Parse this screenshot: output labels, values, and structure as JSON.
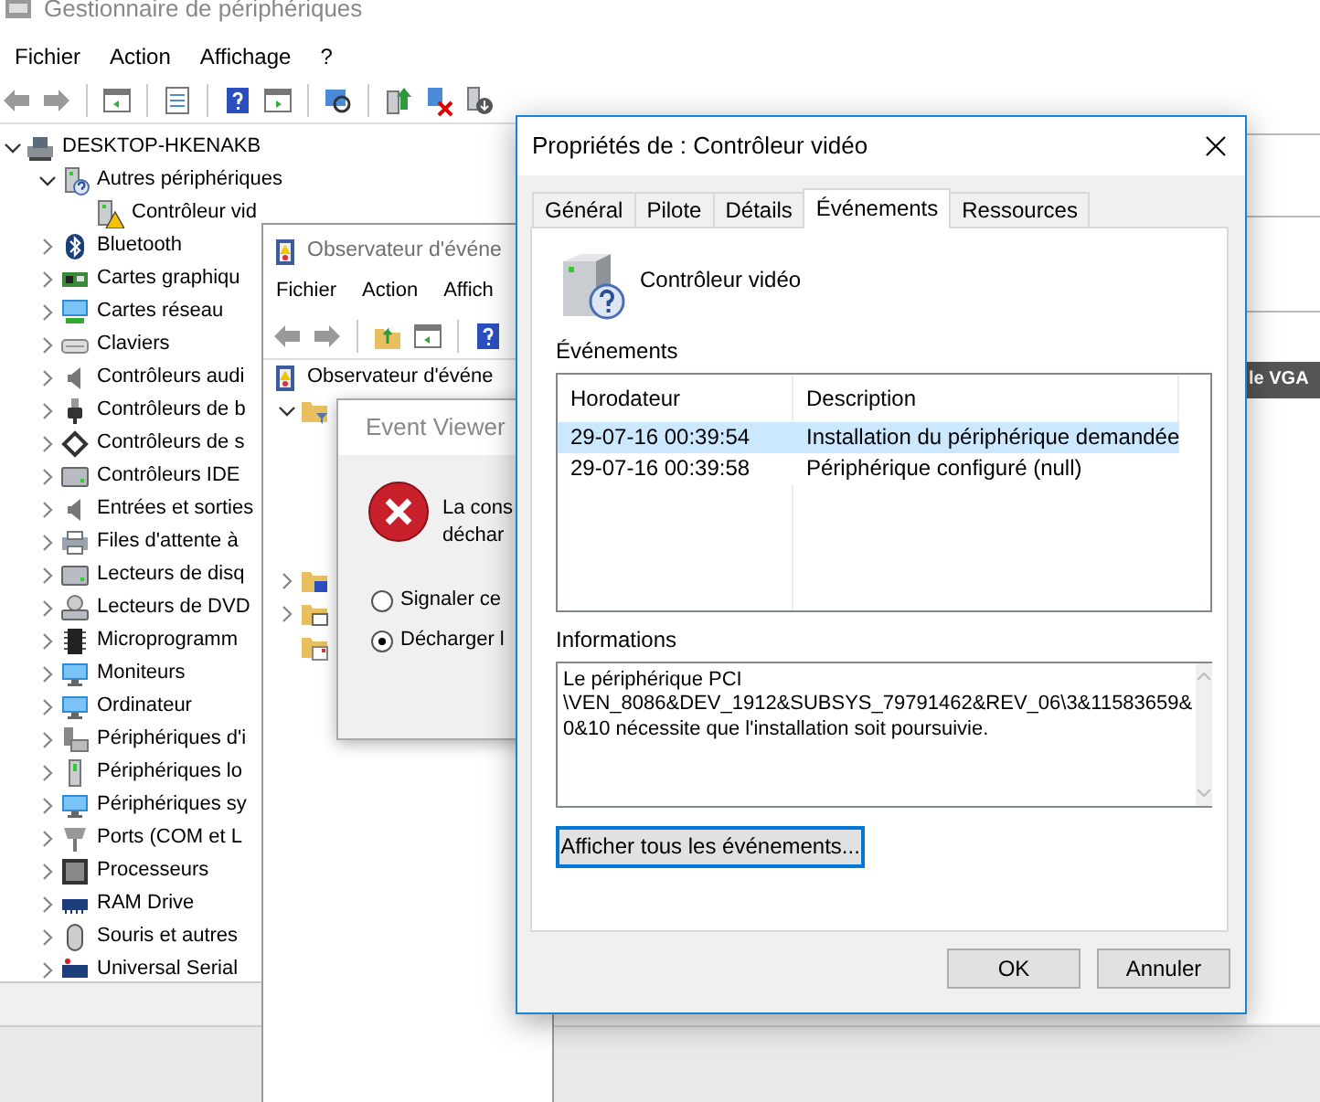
{
  "device_manager": {
    "title": "Gestionnaire de périphériques",
    "menu": [
      "Fichier",
      "Action",
      "Affichage",
      "?"
    ],
    "tree": {
      "label": "DESKTOP-HKENAKB",
      "expanded": true,
      "children": [
        {
          "label": "Autres périphériques",
          "expanded": true,
          "children": [
            {
              "label": "Contrôleur vid",
              "warning": true
            }
          ]
        },
        {
          "label": "Bluetooth",
          "expanded": false
        },
        {
          "label": "Cartes graphiqu",
          "expanded": false
        },
        {
          "label": "Cartes réseau",
          "expanded": false
        },
        {
          "label": "Claviers",
          "expanded": false
        },
        {
          "label": "Contrôleurs audi",
          "expanded": false
        },
        {
          "label": "Contrôleurs de b",
          "expanded": false
        },
        {
          "label": "Contrôleurs de s",
          "expanded": false
        },
        {
          "label": "Contrôleurs IDE",
          "expanded": false
        },
        {
          "label": "Entrées et sorties",
          "expanded": false
        },
        {
          "label": "Files d'attente à",
          "expanded": false
        },
        {
          "label": "Lecteurs de disq",
          "expanded": false
        },
        {
          "label": "Lecteurs de DVD",
          "expanded": false
        },
        {
          "label": "Microprogramm",
          "expanded": false
        },
        {
          "label": "Moniteurs",
          "expanded": false
        },
        {
          "label": "Ordinateur",
          "expanded": false
        },
        {
          "label": "Périphériques d'i",
          "expanded": false
        },
        {
          "label": "Périphériques lo",
          "expanded": false
        },
        {
          "label": "Périphériques sy",
          "expanded": false
        },
        {
          "label": "Ports (COM et L",
          "expanded": false
        },
        {
          "label": "Processeurs",
          "expanded": false
        },
        {
          "label": "RAM Drive",
          "expanded": false
        },
        {
          "label": "Souris et autres",
          "expanded": false
        },
        {
          "label": "Universal Serial",
          "expanded": false
        }
      ]
    }
  },
  "background_window": {
    "heading": "le VGA"
  },
  "event_viewer": {
    "title": "Observateur d'événe",
    "menu": [
      "Fichier",
      "Action",
      "Affich"
    ],
    "tree": [
      {
        "label": "Observateur d'événe",
        "children": [
          {
            "kind": "filter",
            "expanded": true
          },
          {
            "kind": "folder",
            "expanded": false
          },
          {
            "kind": "folder",
            "expanded": false
          },
          {
            "kind": "folder"
          }
        ]
      }
    ]
  },
  "error_dialog": {
    "title": "Event Viewer",
    "message": [
      "La cons",
      "déchar"
    ],
    "options": [
      {
        "label": "Signaler ce",
        "selected": false
      },
      {
        "label": "Décharger l",
        "selected": true
      }
    ]
  },
  "properties": {
    "title": "Propriétés de : Contrôleur vidéo",
    "tabs": [
      {
        "label": "Général",
        "selected": false
      },
      {
        "label": "Pilote",
        "selected": false
      },
      {
        "label": "Détails",
        "selected": false
      },
      {
        "label": "Événements",
        "selected": true
      },
      {
        "label": "Ressources",
        "selected": false
      }
    ],
    "device_name": "Contrôleur vidéo",
    "events_label": "Événements",
    "events_table": {
      "columns": [
        "Horodateur",
        "Description"
      ],
      "rows": [
        {
          "cells": [
            "29-07-16 00:39:54",
            "Installation du périphérique demandée"
          ],
          "selected": true
        },
        {
          "cells": [
            "29-07-16 00:39:58",
            "Périphérique configuré (null)"
          ],
          "selected": false
        }
      ]
    },
    "info_label": "Informations",
    "info_lines": [
      "Le périphérique PCI",
      "\\VEN_8086&DEV_1912&SUBSYS_79791462&REV_06\\3&11583659&",
      "0&10 nécessite que l'installation soit poursuivie."
    ],
    "show_all_button": "Afficher tous les événements...",
    "buttons": [
      "OK",
      "Annuler"
    ]
  }
}
